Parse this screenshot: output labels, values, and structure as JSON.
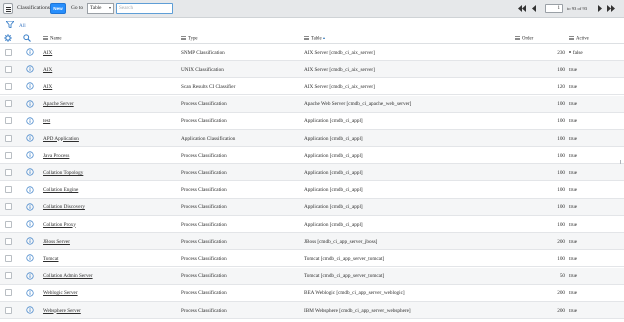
{
  "header": {
    "title": "Classifications",
    "new_label": "New",
    "goto_label": "Go to",
    "goto_field": "Table",
    "search_placeholder": "Search",
    "page_value": "1",
    "page_of": "to 93 of 93"
  },
  "filter": {
    "all_label": "All"
  },
  "columns": {
    "name": "Name",
    "type": "Type",
    "table": "Table",
    "order": "Order",
    "active": "Active"
  },
  "rows": [
    {
      "name": "AIX",
      "type": "SNMP Classification",
      "table": "AIX Server [cmdb_ci_aix_server]",
      "order": "230",
      "active": "false"
    },
    {
      "name": "AIX",
      "type": "UNIX Classification",
      "table": "AIX Server [cmdb_ci_aix_server]",
      "order": "100",
      "active": "true"
    },
    {
      "name": "AIX",
      "type": "Scan Results CI Classifier",
      "table": "AIX Server [cmdb_ci_aix_server]",
      "order": "120",
      "active": "true"
    },
    {
      "name": "Apache Server",
      "type": "Process Classification",
      "table": "Apache Web Server [cmdb_ci_apache_web_server]",
      "order": "100",
      "active": "true"
    },
    {
      "name": "test",
      "type": "Process Classification",
      "table": "Application [cmdb_ci_appl]",
      "order": "100",
      "active": "true"
    },
    {
      "name": "APD Application",
      "type": "Application Classification",
      "table": "Application [cmdb_ci_appl]",
      "order": "100",
      "active": "true"
    },
    {
      "name": "Java Process",
      "type": "Process Classification",
      "table": "Application [cmdb_ci_appl]",
      "order": "100",
      "active": "true"
    },
    {
      "name": "Collation Topology",
      "type": "Process Classification",
      "table": "Application [cmdb_ci_appl]",
      "order": "100",
      "active": "true"
    },
    {
      "name": "Collation Engine",
      "type": "Process Classification",
      "table": "Application [cmdb_ci_appl]",
      "order": "100",
      "active": "true"
    },
    {
      "name": "Collation Discovery",
      "type": "Process Classification",
      "table": "Application [cmdb_ci_appl]",
      "order": "100",
      "active": "true"
    },
    {
      "name": "Collation Proxy",
      "type": "Process Classification",
      "table": "Application [cmdb_ci_appl]",
      "order": "100",
      "active": "true"
    },
    {
      "name": "JBoss Server",
      "type": "Process Classification",
      "table": "JBoss [cmdb_ci_app_server_jboss]",
      "order": "200",
      "active": "true"
    },
    {
      "name": "Tomcat",
      "type": "Process Classification",
      "table": "Tomcat [cmdb_ci_app_server_tomcat]",
      "order": "100",
      "active": "true"
    },
    {
      "name": "Collation Admin Server",
      "type": "Process Classification",
      "table": "Tomcat [cmdb_ci_app_server_tomcat]",
      "order": "50",
      "active": "true"
    },
    {
      "name": "Weblogic Server",
      "type": "Process Classification",
      "table": "BEA Weblogic [cmdb_ci_app_server_weblogic]",
      "order": "200",
      "active": "true"
    },
    {
      "name": "Websphere Server",
      "type": "Process Classification",
      "table": "IBM Websphere [cmdb_ci_app_server_websphere]",
      "order": "200",
      "active": "true"
    }
  ],
  "colors": {
    "header_bg": "#e6e8ea",
    "new_button": "#278efc",
    "info_icon": "#3a7fc8",
    "link_blue": "#3c78c3",
    "alt_row": "#f5f6f7"
  },
  "icons": [
    "hamburger-icon",
    "caret-down-icon",
    "first-page-icon",
    "prev-page-icon",
    "next-page-icon",
    "last-page-icon",
    "funnel-icon",
    "gear-icon",
    "search-icon",
    "info-icon"
  ]
}
